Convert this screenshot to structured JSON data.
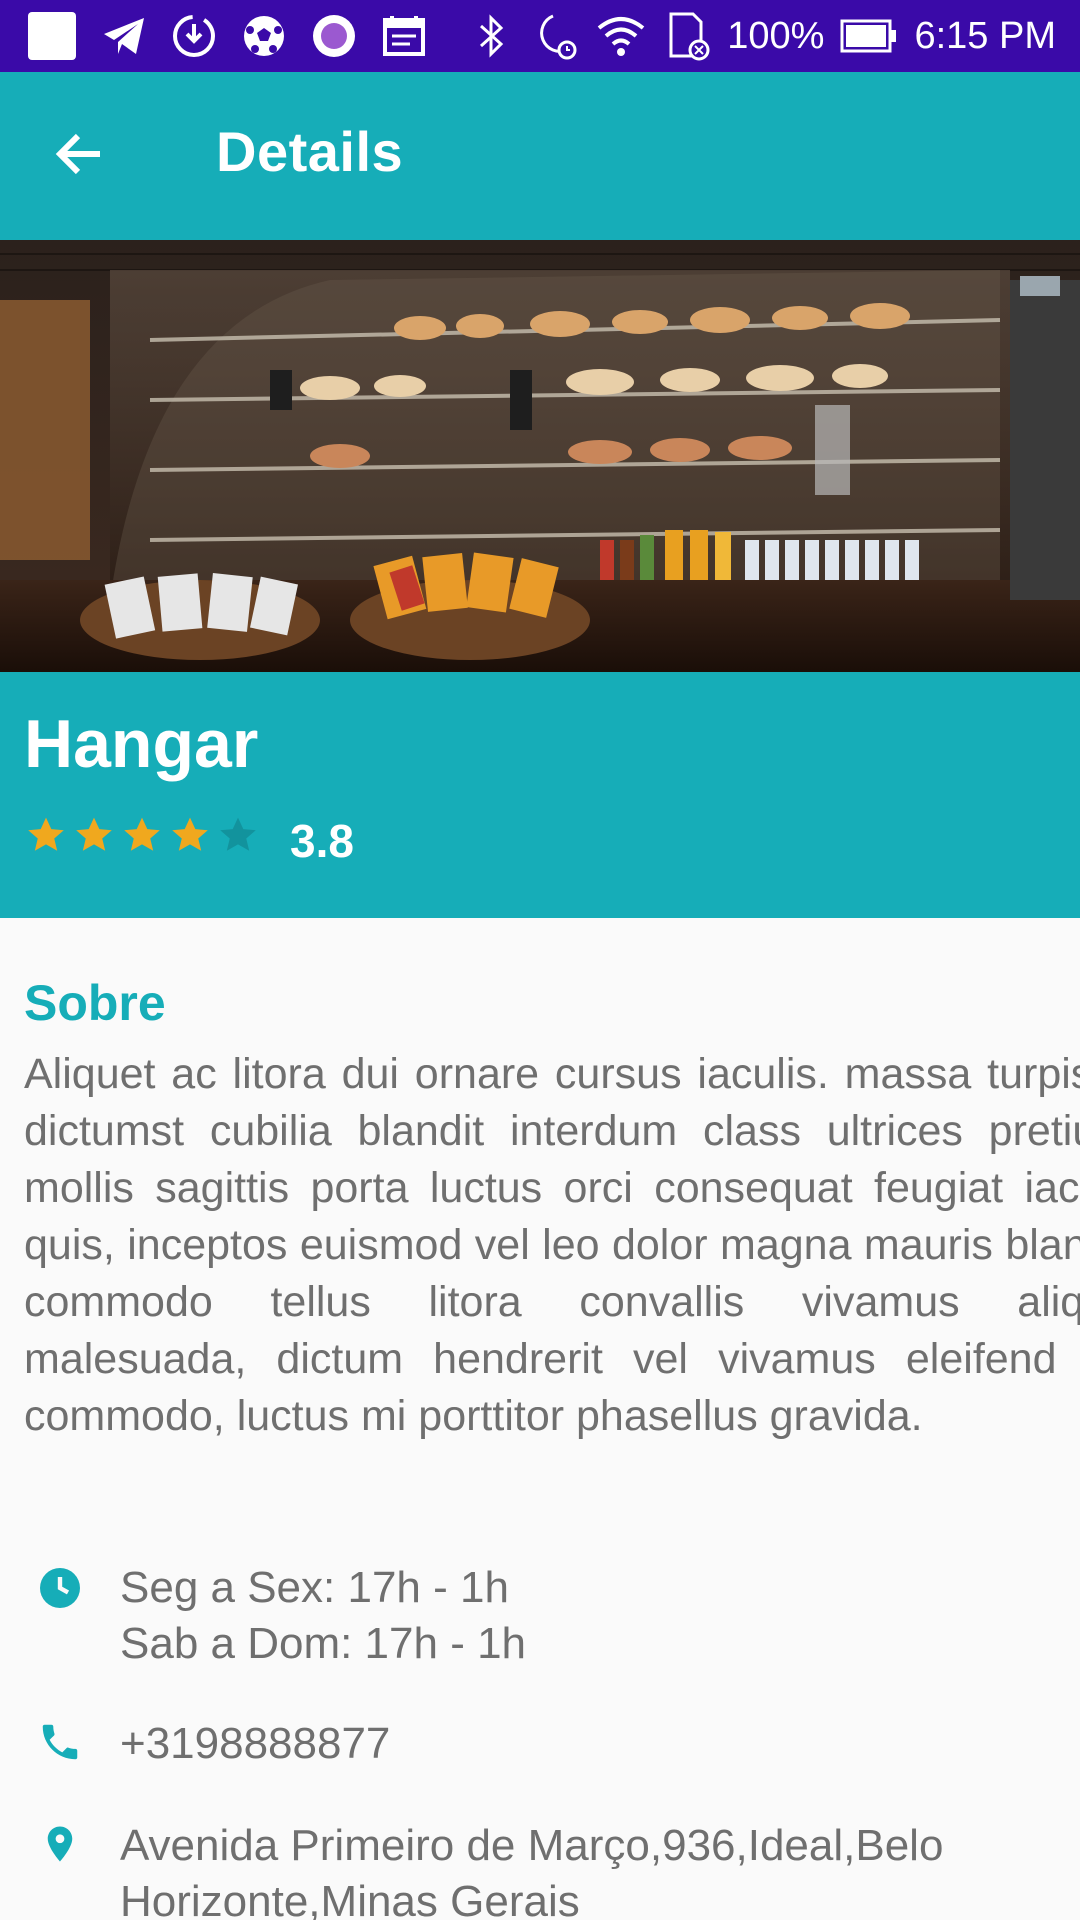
{
  "status_bar": {
    "battery_percent": "100%",
    "time": "6:15 PM",
    "icons": [
      "notification-square-icon",
      "telegram-icon",
      "download-icon",
      "soccer-ball-icon",
      "circle-app-icon",
      "calendar-icon",
      "bluetooth-icon",
      "do-not-disturb-alarm-icon",
      "wifi-icon",
      "sd-card-icon",
      "battery-icon"
    ]
  },
  "app_bar": {
    "title": "Details",
    "back_icon": "arrow-left-icon"
  },
  "place": {
    "name": "Hangar",
    "rating": 3.8,
    "rating_label": "3.8",
    "max_rating": 5
  },
  "about": {
    "heading": "Sobre",
    "text": "Aliquet ac litora dui ornare cursus iaculis. massa turpis at dictumst cubilia blandit interdum class ultrices pretium, mollis sagittis porta luctus orci consequat feugiat iaculis quis, inceptos euismod vel leo dolor magna mauris blandit. commodo tellus litora convallis vivamus aliquet malesuada, dictum hendrerit vel vivamus eleifend est commodo, luctus mi porttitor phasellus gravida."
  },
  "info": {
    "hours_line_1": "Seg a Sex: 17h - 1h",
    "hours_line_2": "Sab a Dom: 17h - 1h",
    "phone": "+3198888877",
    "address_line_1": "Avenida Primeiro de Março,936,Ideal,Belo",
    "address_line_2": "Horizonte,Minas Gerais"
  },
  "colors": {
    "status_bar": "#3a0aa8",
    "primary": "#16adb8",
    "star_filled": "#f0a81e",
    "star_empty": "#12939d",
    "body_text": "#6f6f6f",
    "background": "#fafafa"
  }
}
